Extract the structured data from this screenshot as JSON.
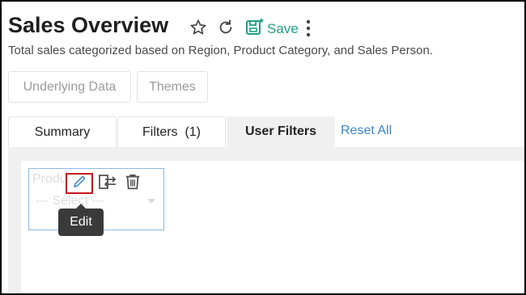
{
  "header": {
    "title": "Sales Overview",
    "save_label": "Save",
    "description": "Total sales categorized based on Region, Product Category, and Sales Person."
  },
  "actions": {
    "underlying_data": "Underlying Data",
    "themes": "Themes"
  },
  "tabs": [
    {
      "label": "Summary"
    },
    {
      "label": "Filters  (1)"
    },
    {
      "label": "User Filters"
    }
  ],
  "reset_all": "Reset All",
  "filter_widget": {
    "label": "Product Category",
    "select_placeholder": "--- Select ---",
    "tooltip": "Edit"
  },
  "colors": {
    "save_accent": "#1f9e84",
    "link": "#3a86d4",
    "highlight_border": "#c4161c",
    "widget_border": "#8cb7e4"
  },
  "icons": [
    "star-icon",
    "refresh-icon",
    "save-icon",
    "more-vertical-icon",
    "edit-pencil-icon",
    "swap-arrows-icon",
    "trash-icon"
  ]
}
